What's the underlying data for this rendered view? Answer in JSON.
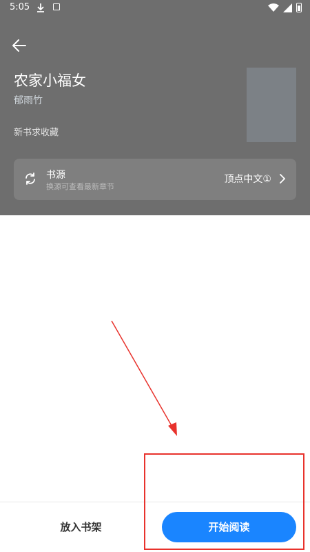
{
  "status_bar": {
    "time": "5:05"
  },
  "book": {
    "title": "农家小福女",
    "author": "郁雨竹",
    "tag": "新书求收藏"
  },
  "source": {
    "label": "书源",
    "hint": "换源可查看最新章节",
    "value": "顶点中文①"
  },
  "actions": {
    "add_to_shelf": "放入书架",
    "start_reading": "开始阅读"
  },
  "colors": {
    "header_bg": "#6e6e6e",
    "primary": "#1a85ff",
    "annotation": "#e8322c"
  }
}
